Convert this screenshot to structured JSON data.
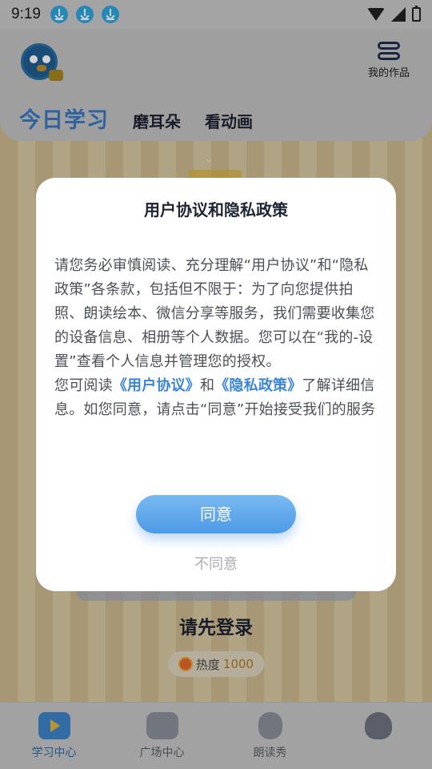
{
  "status_bar": {
    "time": "9:19"
  },
  "header": {
    "my_works_label": "我的作品",
    "tabs": [
      {
        "label": "今日学习",
        "active": true
      },
      {
        "label": "磨耳朵",
        "active": false
      },
      {
        "label": "看动画",
        "active": false
      }
    ]
  },
  "main": {
    "login_title": "请先登录",
    "heat_label": "热度",
    "heat_value": "1000"
  },
  "tabbar": {
    "items": [
      {
        "label": "学习中心",
        "icon": "video-play-icon",
        "active": true
      },
      {
        "label": "广场中心",
        "icon": "calendar-icon",
        "active": false
      },
      {
        "label": "朗读秀",
        "icon": "microphone-icon",
        "active": false
      },
      {
        "label": "",
        "icon": "bird-mascot-icon",
        "active": false
      }
    ]
  },
  "dialog": {
    "title": "用户协议和隐私政策",
    "body_part1": "请您务必审慎阅读、充分理解“用户协议”和“隐私政策”各条款，包括但不限于：为了向您提供拍照、朗读绘本、微信分享等服务，我们需要收集您的设备信息、相册等个人数据。您可以在“我的-设置”查看个人信息并管理您的授权。",
    "body_part2_prefix": "您可阅读",
    "link_user_agreement": "《用户协议》",
    "and_text": "和",
    "link_privacy_policy": "《隐私政策》",
    "body_part2_suffix": "了解详细信息。如您同意，请点击“同意”开始接受我们的服务",
    "agree_label": "同意",
    "disagree_label": "不同意"
  },
  "colors": {
    "accent": "#3a79c4",
    "button_gradient_top": "#79b9f1",
    "button_gradient_bottom": "#4d9ae6",
    "link": "#3a86d4"
  }
}
